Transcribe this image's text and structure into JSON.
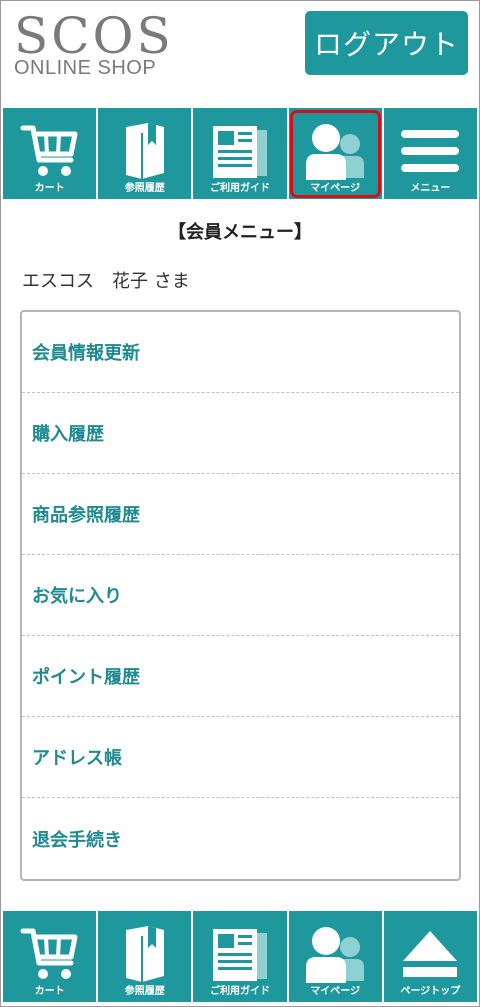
{
  "header": {
    "logo_main": "SCOS",
    "logo_sub": "ONLINE SHOP",
    "logout_label": "ログアウト"
  },
  "nav_top": [
    {
      "label": "カート",
      "icon": "cart-icon"
    },
    {
      "label": "参照履歴",
      "icon": "book-icon"
    },
    {
      "label": "ご利用ガイド",
      "icon": "guide-document-icon"
    },
    {
      "label": "マイページ",
      "icon": "user-icon",
      "active": true
    },
    {
      "label": "メニュー",
      "icon": "hamburger-menu-icon"
    }
  ],
  "nav_bottom": [
    {
      "label": "カート",
      "icon": "cart-icon"
    },
    {
      "label": "参照履歴",
      "icon": "book-icon"
    },
    {
      "label": "ご利用ガイド",
      "icon": "guide-document-icon"
    },
    {
      "label": "マイページ",
      "icon": "user-icon"
    },
    {
      "label": "ページトップ",
      "icon": "eject-up-icon"
    }
  ],
  "page": {
    "title": "【会員メニュー】",
    "member_name": "エスコス　花子 さま"
  },
  "menu": [
    "会員情報更新",
    "購入履歴",
    "商品参照履歴",
    "お気に入り",
    "ポイント履歴",
    "アドレス帳",
    "退会手続き"
  ],
  "colors": {
    "accent": "#1f989d",
    "link": "#1f8a90",
    "active_border": "#d0101a"
  }
}
